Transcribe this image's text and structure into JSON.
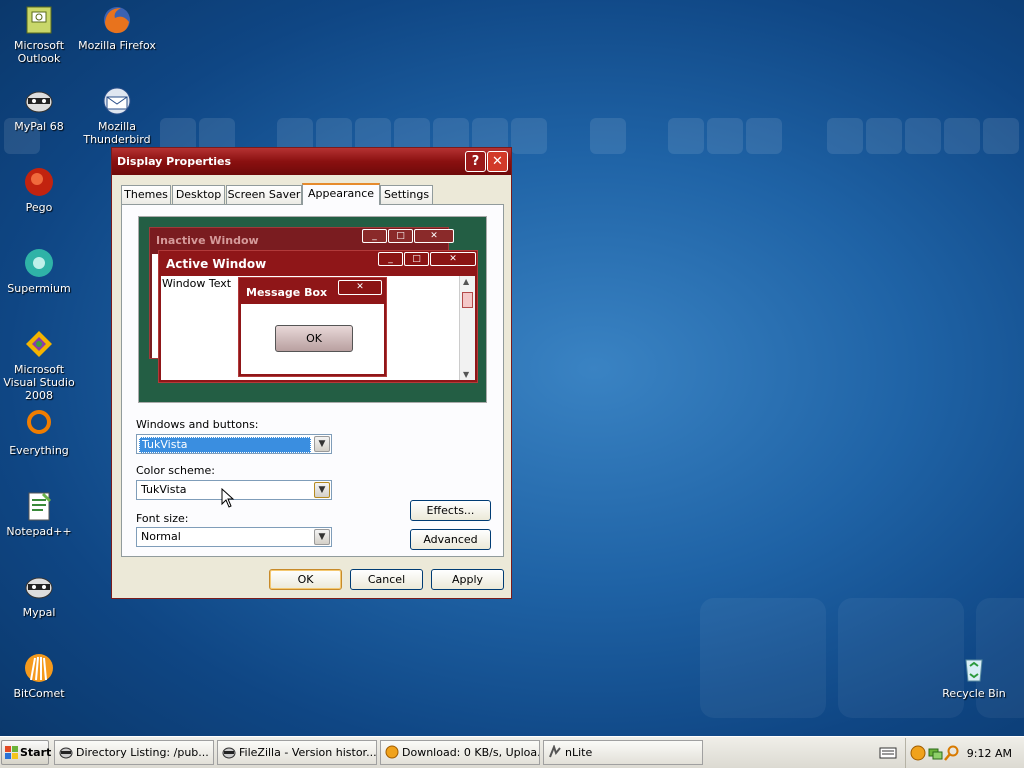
{
  "desktop": {
    "icons": [
      {
        "label": "Microsoft Outlook"
      },
      {
        "label": "Mozilla Firefox"
      },
      {
        "label": "MyPal 68"
      },
      {
        "label": "Mozilla Thunderbird"
      },
      {
        "label": "Pego"
      },
      {
        "label": "Supermium"
      },
      {
        "label": "Microsoft Visual Studio 2008"
      },
      {
        "label": "Everything"
      },
      {
        "label": "Notepad++"
      },
      {
        "label": "Mypal"
      },
      {
        "label": "BitComet"
      },
      {
        "label": "Recycle Bin"
      }
    ]
  },
  "window": {
    "title": "Display Properties",
    "help_glyph": "?",
    "close_glyph": "✕",
    "tabs": [
      "Themes",
      "Desktop",
      "Screen Saver",
      "Appearance",
      "Settings"
    ],
    "active_tab": "Appearance",
    "preview": {
      "inactive_title": "Inactive Window",
      "active_title": "Active Window",
      "window_text": "Window Text",
      "message_title": "Message Box",
      "ok": "OK"
    },
    "windows_buttons_label": "Windows and buttons:",
    "windows_buttons_value": "TukVista",
    "color_scheme_label": "Color scheme:",
    "color_scheme_value": "TukVista",
    "font_size_label": "Font size:",
    "font_size_value": "Normal",
    "effects_button": "Effects...",
    "advanced_button": "Advanced",
    "ok_button": "OK",
    "cancel_button": "Cancel",
    "apply_button": "Apply"
  },
  "taskbar": {
    "start": "Start",
    "tasks": [
      "Directory Listing: /pub...",
      "FileZilla - Version histor...",
      "Download: 0 KB/s, Uploa...",
      "nLite"
    ],
    "clock": "9:12 AM"
  },
  "colors": {
    "accent": "#8a1010",
    "desktop": "#1f63a6"
  }
}
